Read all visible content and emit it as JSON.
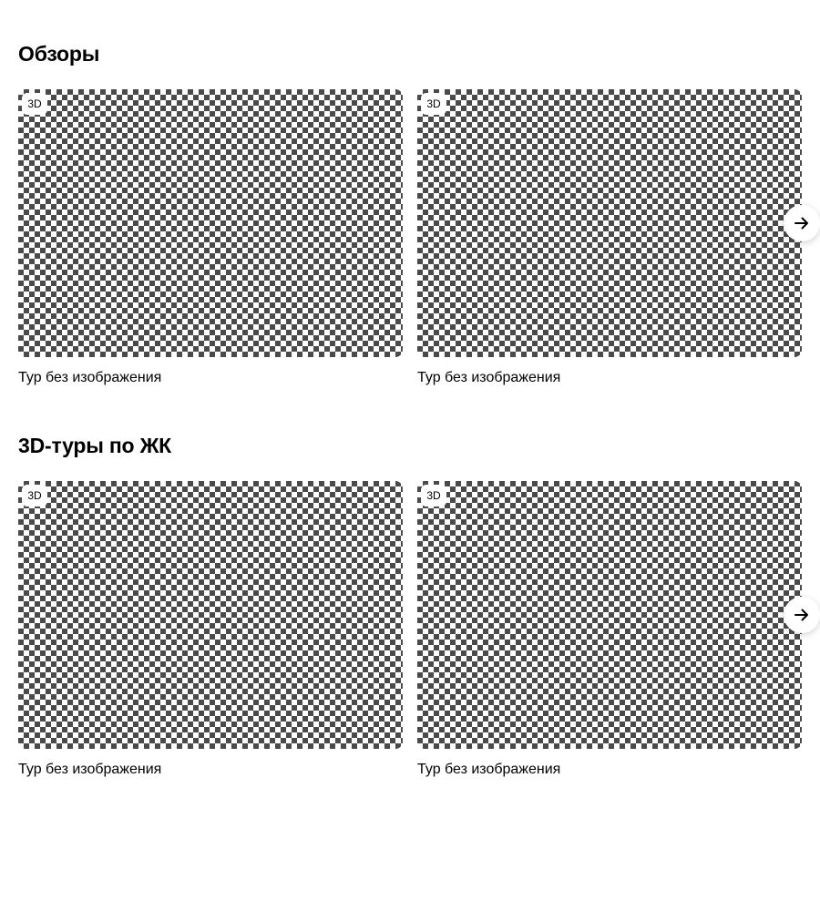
{
  "sections": [
    {
      "title": "Обзоры",
      "cards": [
        {
          "badge": "3D",
          "caption": "Тур без изображения"
        },
        {
          "badge": "3D",
          "caption": "Тур без изображения"
        }
      ],
      "next_icon": "arrow-right-icon"
    },
    {
      "title": "3D-туры по ЖК",
      "cards": [
        {
          "badge": "3D",
          "caption": "Тур без изображения"
        },
        {
          "badge": "3D",
          "caption": "Тур без изображения"
        }
      ],
      "next_icon": "arrow-right-icon"
    }
  ],
  "colors": {
    "background": "#ffffff",
    "text": "#000000",
    "placeholder_dark": "#4a4a4a",
    "placeholder_light": "#ffffff"
  }
}
